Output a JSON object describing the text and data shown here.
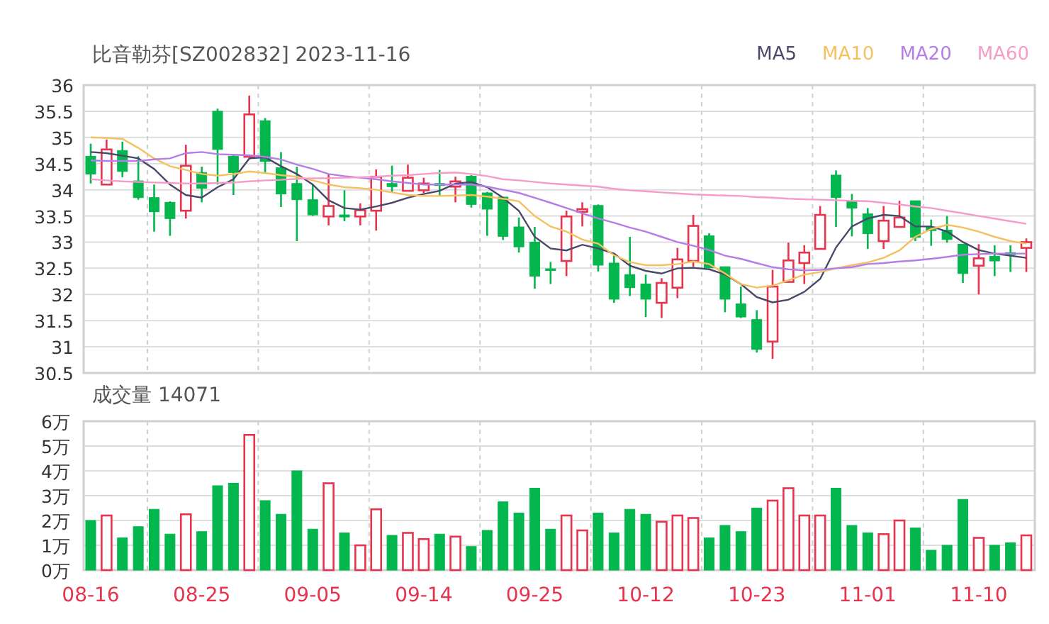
{
  "header": {
    "title": "比音勒芬[SZ002832] 2023-11-16"
  },
  "price_chart": {
    "chart_data": {
      "type": "candlestick",
      "grid": true,
      "ylim": [
        30.5,
        36
      ],
      "yticks": [
        36,
        35.5,
        35,
        34.5,
        34,
        33.5,
        33,
        32.5,
        32,
        31.5,
        31,
        30.5
      ],
      "ohlc": [
        [
          34.64,
          34.88,
          34.12,
          34.3
        ],
        [
          34.1,
          34.96,
          34.1,
          34.77
        ],
        [
          34.75,
          34.92,
          34.24,
          34.35
        ],
        [
          34.17,
          34.64,
          33.81,
          33.85
        ],
        [
          33.85,
          34.1,
          33.2,
          33.58
        ],
        [
          33.76,
          33.78,
          33.12,
          33.45
        ],
        [
          33.6,
          34.86,
          33.45,
          34.46
        ],
        [
          34.33,
          34.44,
          33.76,
          34.03
        ],
        [
          35.5,
          35.55,
          34.1,
          34.77
        ],
        [
          34.64,
          34.66,
          33.9,
          34.33
        ],
        [
          34.63,
          35.8,
          34.63,
          35.44
        ],
        [
          35.32,
          35.37,
          34.33,
          34.54
        ],
        [
          34.42,
          34.72,
          33.67,
          33.92
        ],
        [
          34.12,
          34.44,
          33.02,
          33.81
        ],
        [
          33.81,
          34.1,
          33.5,
          33.52
        ],
        [
          33.49,
          34.3,
          33.32,
          33.69
        ],
        [
          33.52,
          33.99,
          33.4,
          33.48
        ],
        [
          33.49,
          33.74,
          33.32,
          33.61
        ],
        [
          33.6,
          34.39,
          33.22,
          34.25
        ],
        [
          34.12,
          34.46,
          33.96,
          34.06
        ],
        [
          33.98,
          34.48,
          33.98,
          34.23
        ],
        [
          33.99,
          34.23,
          33.94,
          34.12
        ],
        [
          34.12,
          34.38,
          33.88,
          34.08
        ],
        [
          34.06,
          34.25,
          33.76,
          34.16
        ],
        [
          34.26,
          34.28,
          33.66,
          33.72
        ],
        [
          33.94,
          33.96,
          33.12,
          33.63
        ],
        [
          33.86,
          33.86,
          33.04,
          33.11
        ],
        [
          33.29,
          33.47,
          32.8,
          32.91
        ],
        [
          33.0,
          33.29,
          32.11,
          32.35
        ],
        [
          32.49,
          32.62,
          32.2,
          32.46
        ],
        [
          32.64,
          33.6,
          32.35,
          33.49
        ],
        [
          33.58,
          33.76,
          33.3,
          33.63
        ],
        [
          33.7,
          33.72,
          32.44,
          32.56
        ],
        [
          32.6,
          32.74,
          31.84,
          31.91
        ],
        [
          32.38,
          33.1,
          31.97,
          32.13
        ],
        [
          32.2,
          32.38,
          31.57,
          31.91
        ],
        [
          31.84,
          32.31,
          31.55,
          32.22
        ],
        [
          32.13,
          32.89,
          31.93,
          32.67
        ],
        [
          32.64,
          33.52,
          32.53,
          33.31
        ],
        [
          33.12,
          33.17,
          32.51,
          32.51
        ],
        [
          32.53,
          32.53,
          31.66,
          31.91
        ],
        [
          31.82,
          32.15,
          31.55,
          31.57
        ],
        [
          31.52,
          31.7,
          30.89,
          30.95
        ],
        [
          31.1,
          32.47,
          30.77,
          32.15
        ],
        [
          32.24,
          32.99,
          32.24,
          32.65
        ],
        [
          32.6,
          32.94,
          32.2,
          32.8
        ],
        [
          32.87,
          33.69,
          32.87,
          33.52
        ],
        [
          34.28,
          34.37,
          33.29,
          33.85
        ],
        [
          33.78,
          33.92,
          33.11,
          33.65
        ],
        [
          33.54,
          33.65,
          32.87,
          33.16
        ],
        [
          33.02,
          33.69,
          32.87,
          33.41
        ],
        [
          33.29,
          33.79,
          33.29,
          33.47
        ],
        [
          33.79,
          33.79,
          33.02,
          33.09
        ],
        [
          33.29,
          33.43,
          32.93,
          33.22
        ],
        [
          33.23,
          33.5,
          32.99,
          33.05
        ],
        [
          32.96,
          32.96,
          32.22,
          32.4
        ],
        [
          32.55,
          32.96,
          32.0,
          32.69
        ],
        [
          32.73,
          32.94,
          32.35,
          32.64
        ],
        [
          32.8,
          32.94,
          32.43,
          32.76
        ],
        [
          32.89,
          33.07,
          32.43,
          33.0
        ]
      ]
    }
  },
  "moving_averages": {
    "chart_data": {
      "type": "line",
      "ylim": [
        30.5,
        36
      ],
      "series": [
        {
          "name": "MA5",
          "color": "#4a4868",
          "values": [
            34.72,
            34.7,
            34.65,
            34.6,
            34.4,
            34.1,
            33.9,
            33.85,
            34.05,
            34.2,
            34.6,
            34.62,
            34.45,
            34.3,
            34.1,
            33.8,
            33.65,
            33.62,
            33.68,
            33.75,
            33.85,
            33.92,
            33.98,
            34.12,
            34.15,
            34.05,
            33.85,
            33.6,
            33.1,
            32.88,
            32.84,
            32.95,
            32.88,
            32.78,
            32.55,
            32.45,
            32.4,
            32.5,
            32.51,
            32.48,
            32.38,
            32.2,
            31.95,
            31.85,
            31.9,
            32.05,
            32.3,
            32.9,
            33.3,
            33.45,
            33.52,
            33.5,
            33.3,
            33.3,
            33.2,
            33.0,
            32.85,
            32.78,
            32.74,
            32.7
          ]
        },
        {
          "name": "MA10",
          "color": "#f5c060",
          "values": [
            35.0,
            34.99,
            34.97,
            34.8,
            34.6,
            34.45,
            34.38,
            34.3,
            34.27,
            34.3,
            34.35,
            34.32,
            34.28,
            34.25,
            34.18,
            34.1,
            34.05,
            34.03,
            34.0,
            33.95,
            33.9,
            33.88,
            33.88,
            33.89,
            33.9,
            33.87,
            33.83,
            33.78,
            33.5,
            33.3,
            33.2,
            33.05,
            32.97,
            32.75,
            32.62,
            32.56,
            32.56,
            32.58,
            32.63,
            32.58,
            32.4,
            32.2,
            32.13,
            32.17,
            32.27,
            32.38,
            32.43,
            32.5,
            32.56,
            32.61,
            32.7,
            32.84,
            33.1,
            33.25,
            33.33,
            33.28,
            33.2,
            33.1,
            33.02,
            32.97
          ]
        },
        {
          "name": "MA20",
          "color": "#b47ee6",
          "values": [
            34.56,
            34.55,
            34.55,
            34.55,
            34.58,
            34.6,
            34.7,
            34.72,
            34.68,
            34.67,
            34.66,
            34.63,
            34.58,
            34.48,
            34.4,
            34.3,
            34.26,
            34.23,
            34.2,
            34.16,
            34.13,
            34.1,
            34.1,
            34.1,
            34.1,
            34.06,
            34.0,
            33.94,
            33.85,
            33.75,
            33.65,
            33.55,
            33.45,
            33.37,
            33.28,
            33.2,
            33.1,
            33.0,
            32.93,
            32.85,
            32.74,
            32.68,
            32.6,
            32.52,
            32.48,
            32.46,
            32.47,
            32.5,
            32.52,
            32.58,
            32.6,
            32.63,
            32.65,
            32.68,
            32.72,
            32.76,
            32.77,
            32.78,
            32.78,
            32.78
          ]
        },
        {
          "name": "MA60",
          "color": "#f59cc8",
          "values": [
            34.2,
            34.18,
            34.16,
            34.15,
            34.14,
            34.13,
            34.12,
            34.12,
            34.13,
            34.14,
            34.16,
            34.18,
            34.19,
            34.21,
            34.22,
            34.22,
            34.23,
            34.24,
            34.25,
            34.27,
            34.28,
            34.3,
            34.32,
            34.33,
            34.3,
            34.26,
            34.2,
            34.18,
            34.15,
            34.12,
            34.1,
            34.08,
            34.06,
            34.02,
            33.99,
            33.97,
            33.95,
            33.93,
            33.91,
            33.9,
            33.89,
            33.88,
            33.86,
            33.85,
            33.83,
            33.82,
            33.81,
            33.8,
            33.79,
            33.78,
            33.75,
            33.72,
            33.68,
            33.65,
            33.6,
            33.55,
            33.5,
            33.45,
            33.4,
            33.35
          ]
        }
      ]
    }
  },
  "volume_chart": {
    "title": "成交量 14071",
    "chart_data": {
      "type": "bar",
      "grid": true,
      "ylim": [
        0,
        6
      ],
      "yticks": [
        {
          "value": 6,
          "label": "6万"
        },
        {
          "value": 5,
          "label": "5万"
        },
        {
          "value": 4,
          "label": "4万"
        },
        {
          "value": 3,
          "label": "3万"
        },
        {
          "value": 2,
          "label": "2万"
        },
        {
          "value": 1,
          "label": "1万"
        },
        {
          "value": 0,
          "label": "0万"
        }
      ],
      "categories": [
        "08-16",
        null,
        null,
        null,
        null,
        null,
        null,
        "08-25",
        null,
        null,
        null,
        null,
        null,
        null,
        "09-05",
        null,
        null,
        null,
        null,
        null,
        null,
        "09-14",
        null,
        null,
        null,
        null,
        null,
        null,
        "09-25",
        null,
        null,
        null,
        null,
        null,
        null,
        "10-12",
        null,
        null,
        null,
        null,
        null,
        null,
        "10-23",
        null,
        null,
        null,
        null,
        null,
        null,
        "11-01",
        null,
        null,
        null,
        null,
        null,
        null,
        "11-10",
        null,
        null,
        null
      ],
      "values": [
        2.0,
        2.2,
        1.3,
        1.75,
        2.45,
        1.45,
        2.25,
        1.55,
        3.4,
        3.5,
        5.45,
        2.8,
        2.25,
        4.0,
        1.65,
        3.5,
        1.5,
        1.0,
        2.45,
        1.4,
        1.5,
        1.25,
        1.45,
        1.35,
        0.95,
        1.6,
        2.75,
        2.3,
        3.3,
        1.65,
        2.2,
        1.6,
        2.3,
        1.5,
        2.45,
        2.25,
        1.95,
        2.2,
        2.1,
        1.3,
        1.8,
        1.55,
        2.5,
        2.8,
        3.3,
        2.2,
        2.2,
        3.3,
        1.8,
        1.5,
        1.45,
        2.0,
        1.7,
        0.8,
        1.0,
        2.85,
        1.3,
        1.0,
        1.1,
        1.4
      ]
    }
  }
}
